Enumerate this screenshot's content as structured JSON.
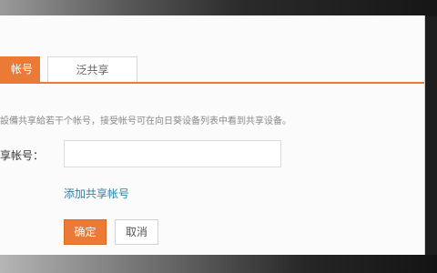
{
  "tabs": [
    {
      "label": "帐号",
      "active": true
    },
    {
      "label": "泛共享",
      "active": false
    }
  ],
  "description": "設備共享給若干个帐号，接受帐号可在向日葵设备列表中看到共享设备。",
  "form": {
    "field_label": "享帐号：",
    "field_value": "",
    "add_link": "添加共享帐号"
  },
  "buttons": {
    "ok": "确定",
    "cancel": "取消"
  },
  "colors": {
    "accent": "#ea7a35",
    "link": "#2f7fa8"
  }
}
